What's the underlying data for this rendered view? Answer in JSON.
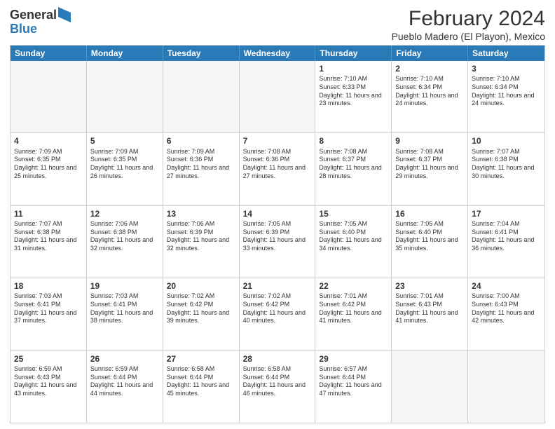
{
  "header": {
    "logo_general": "General",
    "logo_blue": "Blue",
    "month_title": "February 2024",
    "location": "Pueblo Madero (El Playon), Mexico"
  },
  "weekdays": [
    "Sunday",
    "Monday",
    "Tuesday",
    "Wednesday",
    "Thursday",
    "Friday",
    "Saturday"
  ],
  "rows": [
    [
      {
        "day": "",
        "info": "",
        "empty": true
      },
      {
        "day": "",
        "info": "",
        "empty": true
      },
      {
        "day": "",
        "info": "",
        "empty": true
      },
      {
        "day": "",
        "info": "",
        "empty": true
      },
      {
        "day": "1",
        "info": "Sunrise: 7:10 AM\nSunset: 6:33 PM\nDaylight: 11 hours and 23 minutes.",
        "empty": false
      },
      {
        "day": "2",
        "info": "Sunrise: 7:10 AM\nSunset: 6:34 PM\nDaylight: 11 hours and 24 minutes.",
        "empty": false
      },
      {
        "day": "3",
        "info": "Sunrise: 7:10 AM\nSunset: 6:34 PM\nDaylight: 11 hours and 24 minutes.",
        "empty": false
      }
    ],
    [
      {
        "day": "4",
        "info": "Sunrise: 7:09 AM\nSunset: 6:35 PM\nDaylight: 11 hours and 25 minutes.",
        "empty": false
      },
      {
        "day": "5",
        "info": "Sunrise: 7:09 AM\nSunset: 6:35 PM\nDaylight: 11 hours and 26 minutes.",
        "empty": false
      },
      {
        "day": "6",
        "info": "Sunrise: 7:09 AM\nSunset: 6:36 PM\nDaylight: 11 hours and 27 minutes.",
        "empty": false
      },
      {
        "day": "7",
        "info": "Sunrise: 7:08 AM\nSunset: 6:36 PM\nDaylight: 11 hours and 27 minutes.",
        "empty": false
      },
      {
        "day": "8",
        "info": "Sunrise: 7:08 AM\nSunset: 6:37 PM\nDaylight: 11 hours and 28 minutes.",
        "empty": false
      },
      {
        "day": "9",
        "info": "Sunrise: 7:08 AM\nSunset: 6:37 PM\nDaylight: 11 hours and 29 minutes.",
        "empty": false
      },
      {
        "day": "10",
        "info": "Sunrise: 7:07 AM\nSunset: 6:38 PM\nDaylight: 11 hours and 30 minutes.",
        "empty": false
      }
    ],
    [
      {
        "day": "11",
        "info": "Sunrise: 7:07 AM\nSunset: 6:38 PM\nDaylight: 11 hours and 31 minutes.",
        "empty": false
      },
      {
        "day": "12",
        "info": "Sunrise: 7:06 AM\nSunset: 6:38 PM\nDaylight: 11 hours and 32 minutes.",
        "empty": false
      },
      {
        "day": "13",
        "info": "Sunrise: 7:06 AM\nSunset: 6:39 PM\nDaylight: 11 hours and 32 minutes.",
        "empty": false
      },
      {
        "day": "14",
        "info": "Sunrise: 7:05 AM\nSunset: 6:39 PM\nDaylight: 11 hours and 33 minutes.",
        "empty": false
      },
      {
        "day": "15",
        "info": "Sunrise: 7:05 AM\nSunset: 6:40 PM\nDaylight: 11 hours and 34 minutes.",
        "empty": false
      },
      {
        "day": "16",
        "info": "Sunrise: 7:05 AM\nSunset: 6:40 PM\nDaylight: 11 hours and 35 minutes.",
        "empty": false
      },
      {
        "day": "17",
        "info": "Sunrise: 7:04 AM\nSunset: 6:41 PM\nDaylight: 11 hours and 36 minutes.",
        "empty": false
      }
    ],
    [
      {
        "day": "18",
        "info": "Sunrise: 7:03 AM\nSunset: 6:41 PM\nDaylight: 11 hours and 37 minutes.",
        "empty": false
      },
      {
        "day": "19",
        "info": "Sunrise: 7:03 AM\nSunset: 6:41 PM\nDaylight: 11 hours and 38 minutes.",
        "empty": false
      },
      {
        "day": "20",
        "info": "Sunrise: 7:02 AM\nSunset: 6:42 PM\nDaylight: 11 hours and 39 minutes.",
        "empty": false
      },
      {
        "day": "21",
        "info": "Sunrise: 7:02 AM\nSunset: 6:42 PM\nDaylight: 11 hours and 40 minutes.",
        "empty": false
      },
      {
        "day": "22",
        "info": "Sunrise: 7:01 AM\nSunset: 6:42 PM\nDaylight: 11 hours and 41 minutes.",
        "empty": false
      },
      {
        "day": "23",
        "info": "Sunrise: 7:01 AM\nSunset: 6:43 PM\nDaylight: 11 hours and 41 minutes.",
        "empty": false
      },
      {
        "day": "24",
        "info": "Sunrise: 7:00 AM\nSunset: 6:43 PM\nDaylight: 11 hours and 42 minutes.",
        "empty": false
      }
    ],
    [
      {
        "day": "25",
        "info": "Sunrise: 6:59 AM\nSunset: 6:43 PM\nDaylight: 11 hours and 43 minutes.",
        "empty": false
      },
      {
        "day": "26",
        "info": "Sunrise: 6:59 AM\nSunset: 6:44 PM\nDaylight: 11 hours and 44 minutes.",
        "empty": false
      },
      {
        "day": "27",
        "info": "Sunrise: 6:58 AM\nSunset: 6:44 PM\nDaylight: 11 hours and 45 minutes.",
        "empty": false
      },
      {
        "day": "28",
        "info": "Sunrise: 6:58 AM\nSunset: 6:44 PM\nDaylight: 11 hours and 46 minutes.",
        "empty": false
      },
      {
        "day": "29",
        "info": "Sunrise: 6:57 AM\nSunset: 6:44 PM\nDaylight: 11 hours and 47 minutes.",
        "empty": false
      },
      {
        "day": "",
        "info": "",
        "empty": true
      },
      {
        "day": "",
        "info": "",
        "empty": true
      }
    ]
  ]
}
